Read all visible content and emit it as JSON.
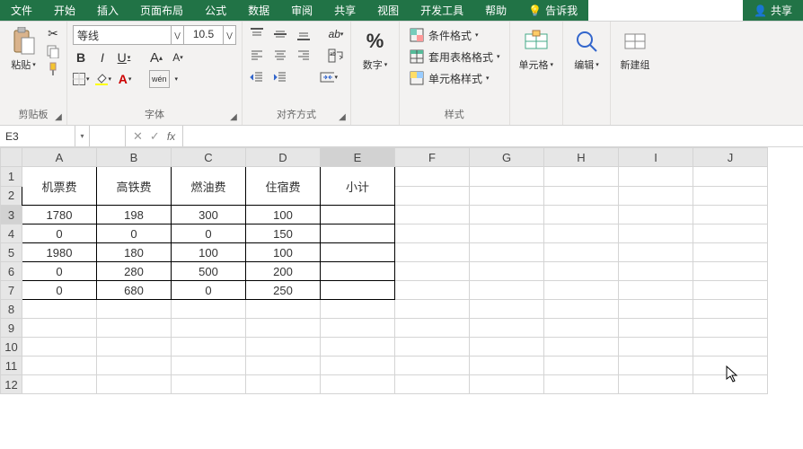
{
  "tabs": {
    "file": "文件",
    "home": "开始",
    "insert": "插入",
    "layout": "页面布局",
    "formulas": "公式",
    "data": "数据",
    "review": "审阅",
    "share_tab": "共享",
    "view": "视图",
    "dev": "开发工具",
    "help": "帮助",
    "tellme": "告诉我",
    "share_btn": "共享"
  },
  "ribbon": {
    "clipboard": {
      "paste": "粘贴",
      "group": "剪贴板"
    },
    "font": {
      "name": "等线",
      "size": "10.5",
      "group": "字体",
      "wen": "wén"
    },
    "align": {
      "group": "对齐方式"
    },
    "number": {
      "label": "数字"
    },
    "styles": {
      "cond": "条件格式",
      "table": "套用表格格式",
      "cell": "单元格样式",
      "group": "样式"
    },
    "cells": {
      "label": "单元格"
    },
    "editing": {
      "label": "编辑"
    },
    "newgroup": {
      "label": "新建组"
    }
  },
  "namebox": "E3",
  "fx_label": "fx",
  "columns": [
    "A",
    "B",
    "C",
    "D",
    "E",
    "F",
    "G",
    "H",
    "I",
    "J"
  ],
  "rows": [
    "1",
    "2",
    "3",
    "4",
    "5",
    "6",
    "7",
    "8",
    "9",
    "10",
    "11",
    "12"
  ],
  "active_col_idx": 4,
  "active_row_idx": 2,
  "headers": [
    "机票费",
    "高铁费",
    "燃油费",
    "住宿费",
    "小计"
  ],
  "data_rows": [
    [
      "1780",
      "198",
      "300",
      "100",
      ""
    ],
    [
      "0",
      "0",
      "0",
      "150",
      ""
    ],
    [
      "1980",
      "180",
      "100",
      "100",
      ""
    ],
    [
      "0",
      "280",
      "500",
      "200",
      ""
    ],
    [
      "0",
      "680",
      "0",
      "250",
      ""
    ]
  ]
}
